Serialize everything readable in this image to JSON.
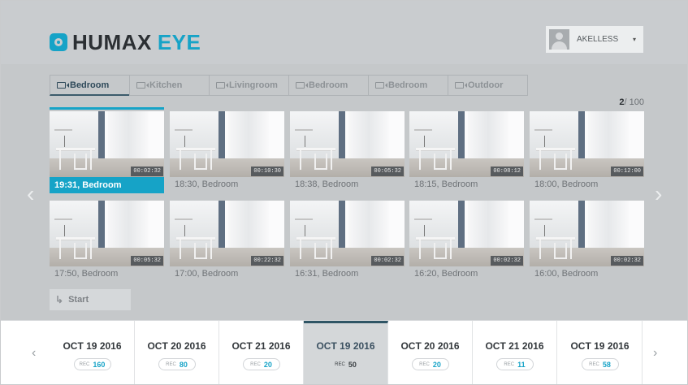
{
  "brand": {
    "name_a": "HUMAX",
    "name_b": "EYE",
    "accent": "#16a3c7"
  },
  "user": {
    "name": "AKELLESS",
    "caret": "▾"
  },
  "tabs": [
    {
      "label": "Bedroom",
      "active": true
    },
    {
      "label": "Kitchen",
      "active": false
    },
    {
      "label": "Livingroom",
      "active": false
    },
    {
      "label": "Bedroom",
      "active": false
    },
    {
      "label": "Bedroom",
      "active": false
    },
    {
      "label": "Outdoor",
      "active": false
    }
  ],
  "page": {
    "current": "2",
    "total": "/ 100"
  },
  "clips": [
    {
      "caption": "19:31, Bedroom",
      "duration": "00:02:32",
      "active": true
    },
    {
      "caption": "18:30, Bedroom",
      "duration": "00:10:30",
      "active": false
    },
    {
      "caption": "18:38, Bedroom",
      "duration": "00:05:32",
      "active": false
    },
    {
      "caption": "18:15, Bedroom",
      "duration": "00:08:12",
      "active": false
    },
    {
      "caption": "18:00, Bedroom",
      "duration": "00:12:00",
      "active": false
    },
    {
      "caption": "17:50, Bedroom",
      "duration": "00:05:32",
      "active": false
    },
    {
      "caption": "17:00, Bedroom",
      "duration": "00:22:32",
      "active": false
    },
    {
      "caption": "16:31, Bedroom",
      "duration": "00:02:32",
      "active": false
    },
    {
      "caption": "16:20, Bedroom",
      "duration": "00:02:32",
      "active": false
    },
    {
      "caption": "16:00, Bedroom",
      "duration": "00:02:32",
      "active": false
    }
  ],
  "nav": {
    "prev": "‹",
    "next": "›"
  },
  "start": {
    "label": "Start"
  },
  "dates": [
    {
      "date": "OCT 19 2016",
      "rec_label": "REC",
      "rec": "160",
      "selected": false
    },
    {
      "date": "OCT 20 2016",
      "rec_label": "REC",
      "rec": "80",
      "selected": false
    },
    {
      "date": "OCT 21 2016",
      "rec_label": "REC",
      "rec": "20",
      "selected": false
    },
    {
      "date": "OCT 19 2016",
      "rec_label": "REC",
      "rec": "50",
      "selected": true
    },
    {
      "date": "OCT 20 2016",
      "rec_label": "REC",
      "rec": "20",
      "selected": false
    },
    {
      "date": "OCT 21 2016",
      "rec_label": "REC",
      "rec": "11",
      "selected": false
    },
    {
      "date": "OCT 19 2016",
      "rec_label": "REC",
      "rec": "58",
      "selected": false
    }
  ],
  "date_nav": {
    "prev": "‹",
    "next": "›"
  }
}
